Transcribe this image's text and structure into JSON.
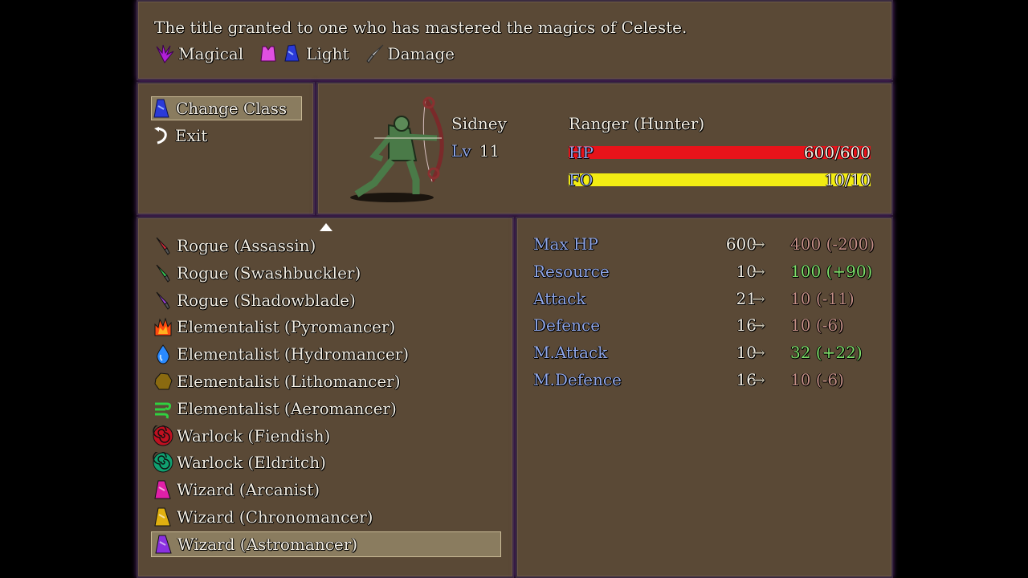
{
  "help": {
    "description": "The title granted to one who has mastered the magics of Celeste.",
    "tags": [
      {
        "icon": "magic-hand-icon",
        "label": "Magical",
        "color": "#b020d8"
      },
      {
        "icon": "light-armor-icon",
        "label": "Light",
        "color": "#e050e0"
      },
      {
        "icon": "damage-dagger-icon",
        "label": "Damage",
        "color": "#b8b8b8"
      }
    ]
  },
  "commands": [
    {
      "label": "Change Class",
      "icon": "wizard-hat-icon",
      "selected": true
    },
    {
      "label": "Exit",
      "icon": "return-arrow-icon",
      "selected": false
    }
  ],
  "actor": {
    "name": "Sidney",
    "level_label": "Lv",
    "level": "11",
    "class": "Ranger (Hunter)",
    "hp": {
      "label": "HP",
      "value": "600/600",
      "fraction": 1.0,
      "color": "#e8131a"
    },
    "fo": {
      "label": "FO",
      "value": "10/10",
      "fraction": 1.0,
      "color": "#f2ec13"
    }
  },
  "classes": [
    {
      "label": "Rogue (Assassin)",
      "icon": "red-dagger-icon",
      "color": "#d8283a"
    },
    {
      "label": "Rogue (Swashbuckler)",
      "icon": "green-dagger-icon",
      "color": "#33cc55"
    },
    {
      "label": "Rogue (Shadowblade)",
      "icon": "purple-dagger-icon",
      "color": "#9a40d8"
    },
    {
      "label": "Elementalist (Pyromancer)",
      "icon": "fire-icon",
      "color": "#ff4a10"
    },
    {
      "label": "Elementalist (Hydromancer)",
      "icon": "water-drop-icon",
      "color": "#2a8aff"
    },
    {
      "label": "Elementalist (Lithomancer)",
      "icon": "rock-icon",
      "color": "#8a6a10"
    },
    {
      "label": "Elementalist (Aeromancer)",
      "icon": "wind-icon",
      "color": "#30d040"
    },
    {
      "label": "Warlock (Fiendish)",
      "icon": "red-spiral-icon",
      "color": "#c01020"
    },
    {
      "label": "Warlock (Eldritch)",
      "icon": "teal-spiral-icon",
      "color": "#10a070"
    },
    {
      "label": "Wizard (Arcanist)",
      "icon": "magenta-hat-icon",
      "color": "#e020a8"
    },
    {
      "label": "Wizard (Chronomancer)",
      "icon": "gold-hat-icon",
      "color": "#e0b010"
    },
    {
      "label": "Wizard (Astromancer)",
      "icon": "violet-hat-icon",
      "color": "#8a30e0"
    }
  ],
  "selected_class_index": 11,
  "stats": [
    {
      "name": "Max HP",
      "current": "600",
      "arrow": "→",
      "new": "400 (-200)",
      "trend": "down"
    },
    {
      "name": "Resource",
      "current": "10",
      "arrow": "→",
      "new": "100 (+90)",
      "trend": "up"
    },
    {
      "name": "Attack",
      "current": "21",
      "arrow": "→",
      "new": "10 (-11)",
      "trend": "down"
    },
    {
      "name": "Defence",
      "current": "16",
      "arrow": "→",
      "new": "10 (-6)",
      "trend": "down"
    },
    {
      "name": "M.Attack",
      "current": "10",
      "arrow": "→",
      "new": "32 (+22)",
      "trend": "up"
    },
    {
      "name": "M.Defence",
      "current": "16",
      "arrow": "→",
      "new": "10 (-6)",
      "trend": "down"
    }
  ]
}
